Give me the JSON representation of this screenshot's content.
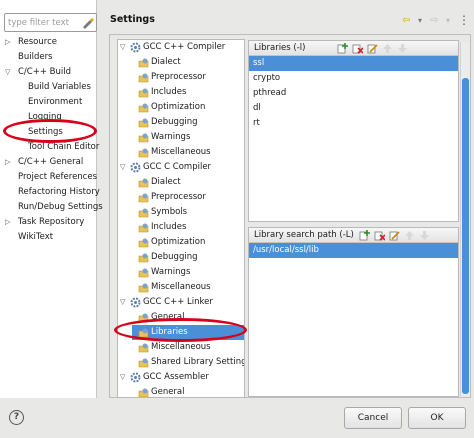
{
  "filter": {
    "placeholder": "type filter text"
  },
  "nav": {
    "items": [
      {
        "label": "Resource",
        "arrow": "▷"
      },
      {
        "label": "Builders",
        "arrow": ""
      },
      {
        "label": "C/C++ Build",
        "arrow": "▽"
      },
      {
        "label": "Build Variables",
        "arrow": ""
      },
      {
        "label": "Environment",
        "arrow": ""
      },
      {
        "label": "Logging",
        "arrow": ""
      },
      {
        "label": "Settings",
        "arrow": ""
      },
      {
        "label": "Tool Chain Editor",
        "arrow": ""
      },
      {
        "label": "C/C++ General",
        "arrow": "▷"
      },
      {
        "label": "Project References",
        "arrow": ""
      },
      {
        "label": "Refactoring History",
        "arrow": ""
      },
      {
        "label": "Run/Debug Settings",
        "arrow": ""
      },
      {
        "label": "Task Repository",
        "arrow": "▷"
      },
      {
        "label": "WikiText",
        "arrow": ""
      }
    ]
  },
  "header": {
    "title": "Settings",
    "back_icon": "⇦",
    "menu_icon": "▾",
    "fwd_icon": "⇨"
  },
  "tree": {
    "items": [
      {
        "label": "GCC C++ Compiler",
        "toggle": "▽"
      },
      {
        "label": "Dialect"
      },
      {
        "label": "Preprocessor"
      },
      {
        "label": "Includes"
      },
      {
        "label": "Optimization"
      },
      {
        "label": "Debugging"
      },
      {
        "label": "Warnings"
      },
      {
        "label": "Miscellaneous"
      },
      {
        "label": "GCC C Compiler",
        "toggle": "▽"
      },
      {
        "label": "Dialect"
      },
      {
        "label": "Preprocessor"
      },
      {
        "label": "Symbols"
      },
      {
        "label": "Includes"
      },
      {
        "label": "Optimization"
      },
      {
        "label": "Debugging"
      },
      {
        "label": "Warnings"
      },
      {
        "label": "Miscellaneous"
      },
      {
        "label": "GCC C++ Linker",
        "toggle": "▽"
      },
      {
        "label": "General"
      },
      {
        "label": "Libraries"
      },
      {
        "label": "Miscellaneous"
      },
      {
        "label": "Shared Library Settings"
      },
      {
        "label": "GCC Assembler",
        "toggle": "▽"
      },
      {
        "label": "General"
      }
    ]
  },
  "libraries": {
    "title": "Libraries (-l)",
    "items": [
      "ssl",
      "crypto",
      "pthread",
      "dl",
      "rt"
    ]
  },
  "search_paths": {
    "title": "Library search path (-L)",
    "items": [
      "/usr/local/ssl/lib"
    ]
  },
  "footer": {
    "help": "?",
    "cancel": "Cancel",
    "ok": "OK"
  },
  "colors": {
    "selection": "#4a90d9",
    "highlight": "#d9001b"
  }
}
